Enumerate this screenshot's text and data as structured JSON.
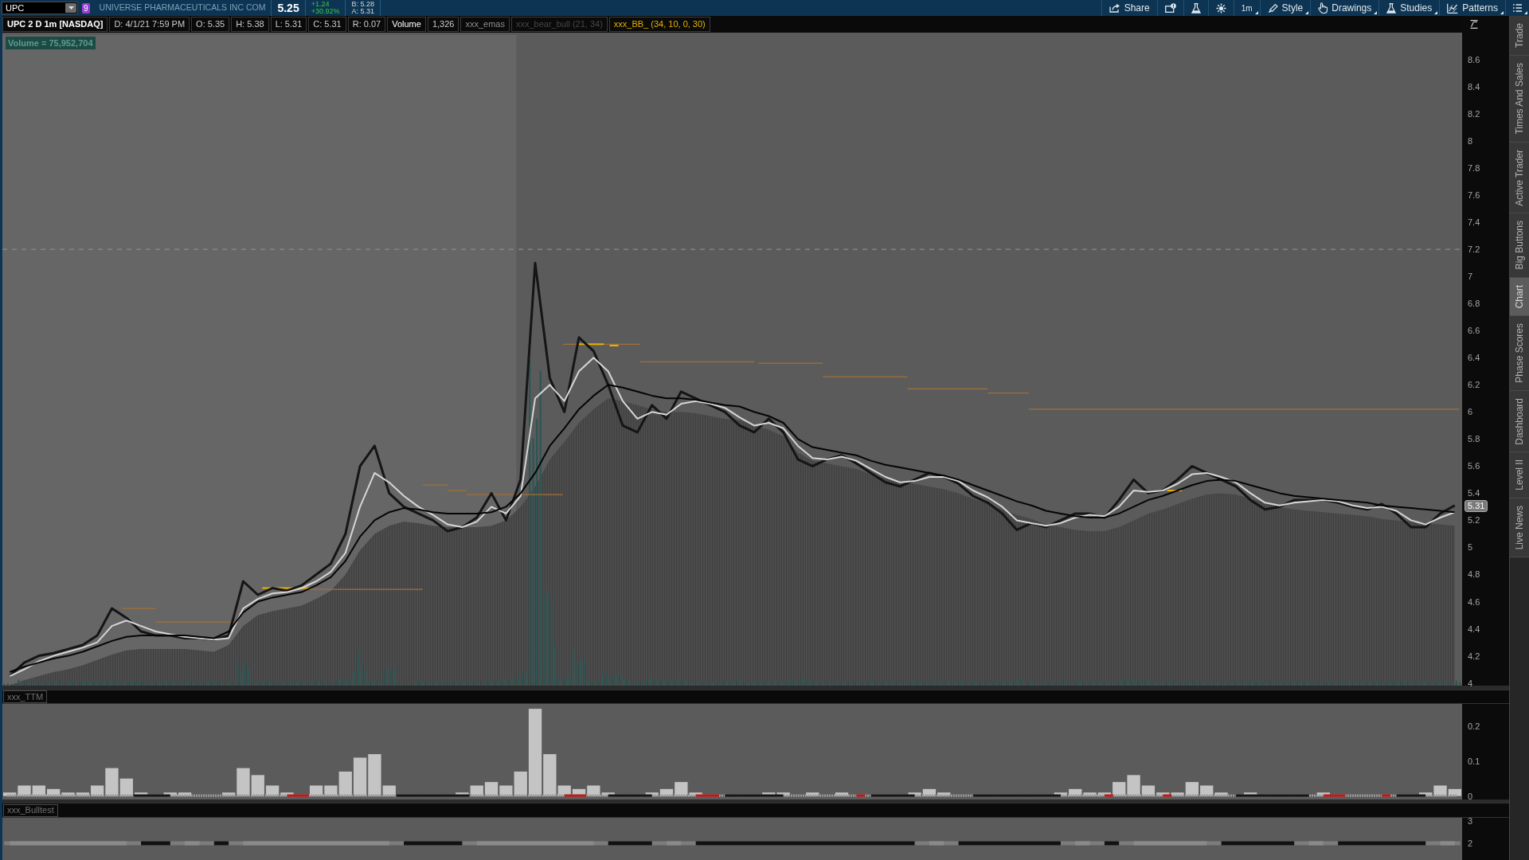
{
  "top_bar": {
    "symbol": "UPC",
    "link_badge": "9",
    "company": "UNIVERSE PHARMACEUTICALS INC COM",
    "last": "5.25",
    "change": "+1.24",
    "change_pct": "+30.92%",
    "bid": "B: 5.28",
    "ask": "A: 5.31",
    "buttons": [
      {
        "kind": "share",
        "label": "Share",
        "dropdown": false
      },
      {
        "kind": "alert",
        "dropdown": false
      },
      {
        "kind": "flask",
        "dropdown": false
      },
      {
        "kind": "gear",
        "dropdown": false
      },
      {
        "kind": "text",
        "label": "1m",
        "dropdown": true
      },
      {
        "kind": "style",
        "label": "Style",
        "dropdown": true
      },
      {
        "kind": "drawings",
        "label": "Drawings",
        "dropdown": true
      },
      {
        "kind": "studies",
        "label": "Studies",
        "dropdown": true
      },
      {
        "kind": "patterns",
        "label": "Patterns",
        "dropdown": true
      },
      {
        "kind": "menu",
        "dropdown": true
      }
    ]
  },
  "chart_header": {
    "fields": [
      {
        "kind": "title",
        "text": "UPC 2 D 1m [NASDAQ]"
      },
      {
        "kind": "quote",
        "text": "D: 4/1/21 7:59 PM"
      },
      {
        "kind": "quote",
        "text": "O: 5.35"
      },
      {
        "kind": "quote",
        "text": "H: 5.38"
      },
      {
        "kind": "quote",
        "text": "L: 5.31"
      },
      {
        "kind": "quote",
        "text": "C: 5.31"
      },
      {
        "kind": "quote",
        "text": "R: 0.07"
      },
      {
        "kind": "study",
        "text": "Volume"
      },
      {
        "kind": "quote",
        "text": "1,326"
      },
      {
        "kind": "study_dim",
        "text": "xxx_emas"
      },
      {
        "kind": "study_hidden",
        "text": "xxx_bear_bull (21, 34)"
      },
      {
        "kind": "study_active",
        "text": "xxx_BB_ (34, 10, 0, 30)"
      }
    ]
  },
  "price_chart": {
    "volume_label": "Volume = 75,952,704",
    "last_price": "5.31",
    "chart_data": {
      "type": "line",
      "ylim": [
        3.98,
        8.8
      ],
      "yticks": [
        8.6,
        8.4,
        8.2,
        8,
        7.8,
        7.6,
        7.4,
        7.2,
        7,
        6.8,
        6.6,
        6.4,
        6.2,
        6,
        5.8,
        5.6,
        5.4,
        5.2,
        5,
        4.8,
        4.6,
        4.4,
        4.2,
        4
      ],
      "categories": [
        null,
        null,
        null,
        null,
        null,
        null,
        null,
        null,
        null,
        null,
        null,
        null,
        null,
        null,
        null,
        null,
        null,
        null,
        null,
        null,
        null,
        null,
        null,
        null,
        null,
        null,
        null,
        null,
        null,
        null,
        null,
        null,
        null,
        null,
        null,
        null,
        null,
        null,
        null,
        null,
        null,
        null,
        null,
        null,
        null,
        null,
        null,
        null,
        null,
        null,
        null,
        null,
        null,
        null,
        null,
        null,
        null,
        null,
        null,
        null,
        null,
        null,
        null,
        null,
        null,
        null,
        null,
        null,
        null,
        null,
        null,
        null,
        null,
        null,
        null,
        null,
        null,
        null,
        null,
        null,
        null,
        null,
        null,
        null,
        null,
        null,
        null,
        null,
        null,
        null,
        null,
        null,
        null,
        null,
        null,
        null,
        null,
        null,
        null,
        null
      ],
      "series": [
        {
          "color": "#151515",
          "values": [
            4.05,
            4.15,
            4.2,
            4.22,
            4.25,
            4.28,
            4.35,
            4.55,
            4.48,
            4.38,
            4.35,
            4.35,
            4.33,
            4.33,
            4.32,
            4.35,
            4.75,
            4.65,
            4.7,
            4.68,
            4.72,
            4.8,
            4.88,
            5.1,
            5.6,
            5.75,
            5.4,
            5.3,
            5.25,
            5.2,
            5.12,
            5.15,
            5.22,
            5.4,
            5.2,
            5.5,
            7.1,
            6.25,
            6.0,
            6.55,
            6.45,
            6.2,
            5.9,
            5.85,
            6.05,
            5.95,
            6.15,
            6.1,
            6.05,
            6.0,
            5.9,
            5.85,
            5.95,
            5.85,
            5.65,
            5.6,
            5.65,
            5.68,
            5.62,
            5.55,
            5.48,
            5.45,
            5.5,
            5.55,
            5.52,
            5.47,
            5.38,
            5.33,
            5.25,
            5.13,
            5.18,
            5.15,
            5.2,
            5.25,
            5.25,
            5.22,
            5.35,
            5.5,
            5.4,
            5.42,
            5.5,
            5.6,
            5.55,
            5.5,
            5.45,
            5.35,
            5.28,
            5.3,
            5.35,
            5.35,
            5.35,
            5.33,
            5.3,
            5.28,
            5.32,
            5.25,
            5.15,
            5.15,
            5.25,
            5.31
          ]
        },
        {
          "color": "#d6d6d6",
          "values": [
            4.05,
            4.1,
            4.16,
            4.2,
            4.23,
            4.26,
            4.3,
            4.42,
            4.46,
            4.42,
            4.38,
            4.36,
            4.34,
            4.33,
            4.32,
            4.33,
            4.55,
            4.62,
            4.66,
            4.67,
            4.7,
            4.75,
            4.82,
            4.96,
            5.3,
            5.55,
            5.48,
            5.38,
            5.3,
            5.24,
            5.17,
            5.15,
            5.19,
            5.3,
            5.25,
            5.38,
            6.1,
            6.2,
            6.08,
            6.3,
            6.4,
            6.3,
            6.08,
            5.95,
            6.0,
            5.98,
            6.06,
            6.08,
            6.06,
            6.03,
            5.96,
            5.9,
            5.92,
            5.88,
            5.75,
            5.66,
            5.65,
            5.67,
            5.64,
            5.58,
            5.52,
            5.48,
            5.49,
            5.52,
            5.52,
            5.49,
            5.42,
            5.37,
            5.3,
            5.2,
            5.18,
            5.16,
            5.18,
            5.22,
            5.24,
            5.23,
            5.3,
            5.42,
            5.41,
            5.42,
            5.47,
            5.54,
            5.55,
            5.52,
            5.48,
            5.4,
            5.33,
            5.31,
            5.33,
            5.34,
            5.35,
            5.34,
            5.31,
            5.29,
            5.3,
            5.27,
            5.2,
            5.17,
            5.22,
            5.26
          ]
        },
        {
          "color": "#050505",
          "values": [
            4.08,
            4.12,
            4.15,
            4.18,
            4.2,
            4.23,
            4.27,
            4.31,
            4.34,
            4.35,
            4.35,
            4.35,
            4.35,
            4.34,
            4.33,
            4.38,
            4.52,
            4.6,
            4.63,
            4.65,
            4.67,
            4.72,
            4.78,
            4.9,
            5.08,
            5.2,
            5.26,
            5.29,
            5.28,
            5.26,
            5.25,
            5.25,
            5.25,
            5.26,
            5.3,
            5.4,
            5.55,
            5.75,
            5.88,
            6.02,
            6.12,
            6.2,
            6.18,
            6.15,
            6.12,
            6.1,
            6.1,
            6.09,
            6.07,
            6.05,
            6.04,
            6.0,
            5.97,
            5.92,
            5.8,
            5.74,
            5.72,
            5.7,
            5.68,
            5.64,
            5.61,
            5.59,
            5.57,
            5.55,
            5.53,
            5.5,
            5.46,
            5.42,
            5.38,
            5.34,
            5.31,
            5.27,
            5.25,
            5.23,
            5.22,
            5.22,
            5.25,
            5.3,
            5.35,
            5.38,
            5.42,
            5.46,
            5.49,
            5.5,
            5.49,
            5.46,
            5.43,
            5.4,
            5.38,
            5.37,
            5.36,
            5.35,
            5.34,
            5.33,
            5.31,
            5.3,
            5.29,
            5.28,
            5.27,
            5.26
          ]
        }
      ]
    }
  },
  "ttm": {
    "title": "xxx_TTM",
    "chart_data": {
      "type": "bar",
      "ylim": [
        -0.01,
        0.264
      ],
      "yticks": [
        0.2,
        0.1,
        0
      ],
      "categories": [
        null,
        null,
        null,
        null,
        null,
        null,
        null,
        null,
        null,
        null,
        null,
        null,
        null,
        null,
        null,
        null,
        null,
        null,
        null,
        null,
        null,
        null,
        null,
        null,
        null,
        null,
        null,
        null,
        null,
        null,
        null,
        null,
        null,
        null,
        null,
        null,
        null,
        null,
        null,
        null,
        null,
        null,
        null,
        null,
        null,
        null,
        null,
        null,
        null,
        null,
        null,
        null,
        null,
        null,
        null,
        null,
        null,
        null,
        null,
        null,
        null,
        null,
        null,
        null,
        null,
        null,
        null,
        null,
        null,
        null,
        null,
        null,
        null,
        null,
        null,
        null,
        null,
        null,
        null,
        null,
        null,
        null,
        null,
        null,
        null,
        null,
        null,
        null,
        null,
        null,
        null,
        null,
        null,
        null,
        null,
        null,
        null,
        null,
        null,
        null
      ],
      "series": [
        {
          "color": "#c4c4c4",
          "values": [
            0.01,
            0.03,
            0.03,
            0.02,
            0.01,
            0.01,
            0.03,
            0.08,
            0.05,
            0.01,
            0,
            0.01,
            0.01,
            0,
            0,
            0.01,
            0.08,
            0.06,
            0.03,
            0.01,
            0,
            0.03,
            0.03,
            0.07,
            0.11,
            0.12,
            0.03,
            0,
            0,
            0,
            0,
            0.01,
            0.03,
            0.04,
            0.03,
            0.07,
            0.25,
            0.12,
            0.03,
            0.02,
            0.03,
            0.01,
            0,
            0,
            0.01,
            0.02,
            0.04,
            0.01,
            0,
            0,
            0,
            0,
            0.01,
            0.01,
            0,
            0.01,
            0,
            0.01,
            0,
            0,
            0,
            0,
            0.01,
            0.02,
            0.01,
            0,
            0,
            0,
            0,
            0,
            0,
            0,
            0.01,
            0.02,
            0.01,
            0.01,
            0.04,
            0.06,
            0.03,
            0.01,
            0.01,
            0.04,
            0.03,
            0.01,
            0,
            0.01,
            0,
            0,
            0,
            0,
            0.01,
            0,
            0,
            0,
            0,
            0,
            0,
            0.01,
            0.03,
            0.02
          ]
        }
      ]
    }
  },
  "bulltest": {
    "title": "xxx_Bulltest",
    "chart_data": {
      "type": "line",
      "ylim": [
        1.25,
        3.14
      ],
      "yticks": [
        3,
        2
      ],
      "categories": [
        null,
        null,
        null,
        null,
        null,
        null,
        null,
        null,
        null,
        null,
        null,
        null,
        null,
        null,
        null,
        null,
        null,
        null,
        null,
        null,
        null,
        null,
        null,
        null,
        null,
        null,
        null,
        null,
        null,
        null,
        null,
        null,
        null,
        null,
        null,
        null,
        null,
        null,
        null,
        null,
        null,
        null,
        null,
        null,
        null,
        null,
        null,
        null,
        null,
        null,
        null,
        null,
        null,
        null,
        null,
        null,
        null,
        null,
        null,
        null,
        null,
        null,
        null,
        null,
        null,
        null,
        null,
        null,
        null,
        null,
        null,
        null,
        null,
        null,
        null,
        null,
        null,
        null,
        null,
        null,
        null,
        null,
        null,
        null,
        null,
        null,
        null,
        null,
        null,
        null,
        null,
        null,
        null,
        null,
        null,
        null,
        null,
        null,
        null,
        null
      ],
      "series": [
        {
          "color": "#8a8a8a",
          "values": [
            2,
            2,
            2,
            2,
            2,
            2,
            2,
            2,
            2,
            null,
            null,
            null,
            2,
            2,
            null,
            null,
            2,
            2,
            2,
            2,
            2,
            2,
            2,
            2,
            2,
            2,
            2,
            null,
            null,
            null,
            null,
            null,
            2,
            2,
            2,
            2,
            2,
            2,
            2,
            2,
            2,
            null,
            null,
            null,
            null,
            2,
            2,
            null,
            null,
            null,
            null,
            null,
            null,
            null,
            null,
            null,
            null,
            null,
            null,
            null,
            null,
            null,
            null,
            2,
            2,
            null,
            null,
            null,
            null,
            null,
            null,
            null,
            null,
            2,
            2,
            null,
            null,
            2,
            2,
            2,
            2,
            2,
            2,
            null,
            null,
            null,
            null,
            null,
            null,
            2,
            2,
            null,
            null,
            null,
            null,
            null,
            null,
            null,
            2,
            2
          ]
        },
        {
          "color": "#111111",
          "values": [
            null,
            null,
            null,
            null,
            null,
            null,
            null,
            null,
            null,
            2,
            2,
            2,
            null,
            null,
            2,
            2,
            null,
            null,
            null,
            null,
            null,
            null,
            null,
            null,
            null,
            null,
            null,
            2,
            2,
            2,
            2,
            2,
            null,
            null,
            null,
            null,
            null,
            null,
            null,
            null,
            null,
            2,
            2,
            2,
            2,
            null,
            null,
            2,
            2,
            2,
            2,
            2,
            2,
            2,
            2,
            2,
            2,
            2,
            2,
            2,
            2,
            2,
            2,
            null,
            null,
            2,
            2,
            2,
            2,
            2,
            2,
            2,
            2,
            null,
            null,
            2,
            2,
            null,
            null,
            null,
            null,
            null,
            null,
            2,
            2,
            2,
            2,
            2,
            2,
            null,
            null,
            2,
            2,
            2,
            2,
            2,
            2,
            2,
            null,
            null
          ]
        }
      ]
    }
  },
  "side_tabs": [
    {
      "label": "Trade",
      "selected": false
    },
    {
      "label": "Times And Sales",
      "selected": false
    },
    {
      "label": "Active Trader",
      "selected": false
    },
    {
      "label": "Big Buttons",
      "selected": false
    },
    {
      "label": "Chart",
      "selected": true
    },
    {
      "label": "Phase Scores",
      "selected": false
    },
    {
      "label": "Dashboard",
      "selected": false
    },
    {
      "label": "Level II",
      "selected": false
    },
    {
      "label": "Live News",
      "selected": false
    }
  ]
}
